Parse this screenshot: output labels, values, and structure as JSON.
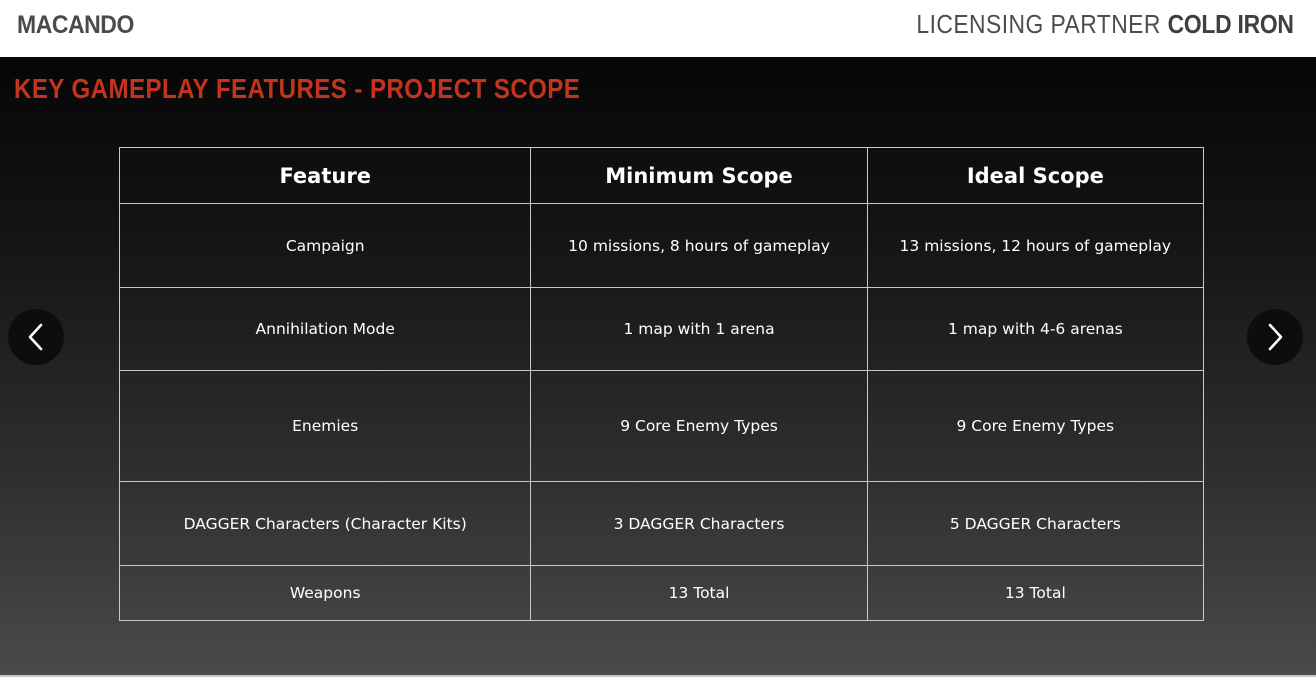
{
  "header": {
    "brand": "MACANDO",
    "partner_prefix": "LICENSING PARTNER",
    "partner_name": "COLD IRON"
  },
  "slide": {
    "title": "KEY GAMEPLAY FEATURES - PROJECT SCOPE",
    "title_color": "#c2341d"
  },
  "table": {
    "headers": [
      "Feature",
      "Minimum Scope",
      "Ideal Scope"
    ],
    "rows": [
      [
        "Campaign",
        "10 missions, 8 hours of gameplay",
        "13 missions, 12 hours of gameplay"
      ],
      [
        "Annihilation Mode",
        "1 map with 1 arena",
        "1 map with 4-6 arenas"
      ],
      [
        "Enemies",
        "9 Core Enemy Types",
        "9 Core Enemy Types"
      ],
      [
        "DAGGER Characters (Character Kits)",
        "3 DAGGER Characters",
        "5 DAGGER Characters"
      ],
      [
        "Weapons",
        "13 Total",
        "13 Total"
      ]
    ]
  },
  "nav": {
    "prev_icon": "chevron-left-icon",
    "next_icon": "chevron-right-icon"
  }
}
